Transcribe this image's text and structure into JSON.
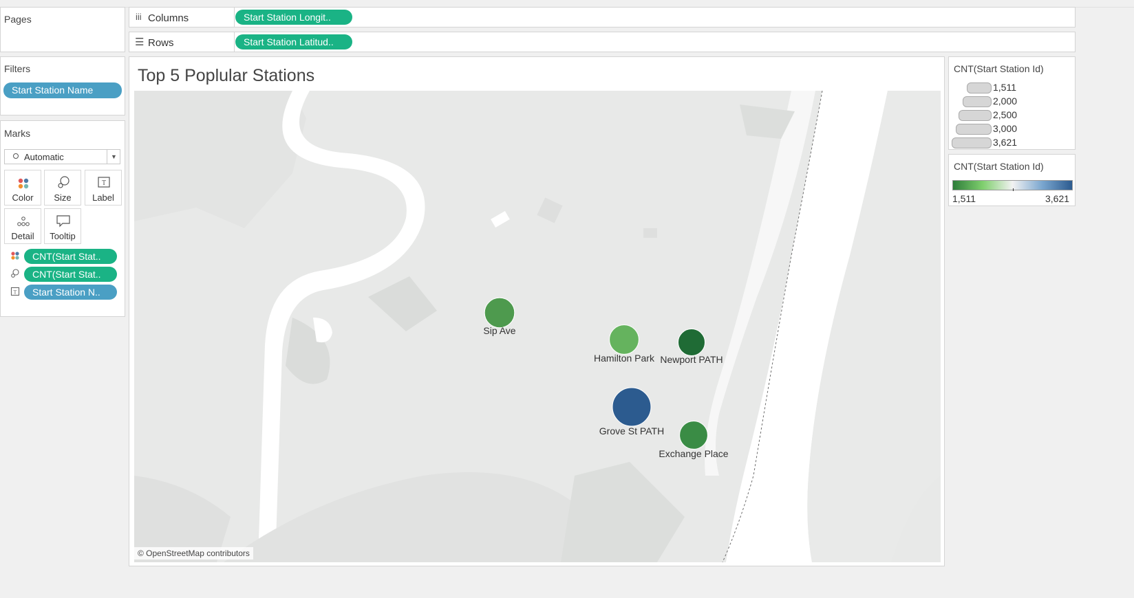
{
  "shelves": {
    "pages_label": "Pages",
    "columns_label": "Columns",
    "columns_pill": "Start Station Longit..",
    "rows_label": "Rows",
    "rows_pill": "Start Station Latitud.."
  },
  "filters": {
    "title": "Filters",
    "pill": "Start Station Name"
  },
  "marks": {
    "title": "Marks",
    "type_select": "Automatic",
    "buttons": [
      {
        "label": "Color",
        "icon": "color-icon"
      },
      {
        "label": "Size",
        "icon": "size-icon"
      },
      {
        "label": "Label",
        "icon": "label-icon"
      },
      {
        "label": "Detail",
        "icon": "detail-icon"
      },
      {
        "label": "Tooltip",
        "icon": "tooltip-icon"
      }
    ],
    "pills": [
      {
        "icon": "color-dots-icon",
        "text": "CNT(Start Stat..",
        "color": "#1ab385"
      },
      {
        "icon": "size-icon",
        "text": "CNT(Start Stat..",
        "color": "#1ab385"
      },
      {
        "icon": "label-icon",
        "text": "Start Station N..",
        "color": "#4a9fc4"
      }
    ]
  },
  "viz": {
    "title": "Top 5 Poplular Stations",
    "attribution": "© OpenStreetMap contributors"
  },
  "legend_size": {
    "title": "CNT(Start Station Id)",
    "items": [
      "1,511",
      "2,000",
      "2,500",
      "3,000",
      "3,621"
    ]
  },
  "legend_color": {
    "title": "CNT(Start Station Id)",
    "min": "1,511",
    "max": "3,621",
    "colors": [
      "#2e7d3a",
      "#7fcf6e",
      "#f2f2f2",
      "#7aa6cf",
      "#2c5b8f"
    ]
  },
  "chart_data": {
    "type": "scatter",
    "title": "Top 5 Poplular Stations",
    "measure": "CNT(Start Station Id)",
    "points": [
      {
        "name": "Sip Ave",
        "count": 2000,
        "color": "#4e9a4e"
      },
      {
        "name": "Hamilton Park",
        "count": 1900,
        "color": "#65b35e"
      },
      {
        "name": "Newport PATH",
        "count": 1511,
        "color": "#1f6b35"
      },
      {
        "name": "Grove St PATH",
        "count": 3621,
        "color": "#2c5b8f"
      },
      {
        "name": "Exchange Place",
        "count": 1700,
        "color": "#3a8c45"
      }
    ]
  }
}
